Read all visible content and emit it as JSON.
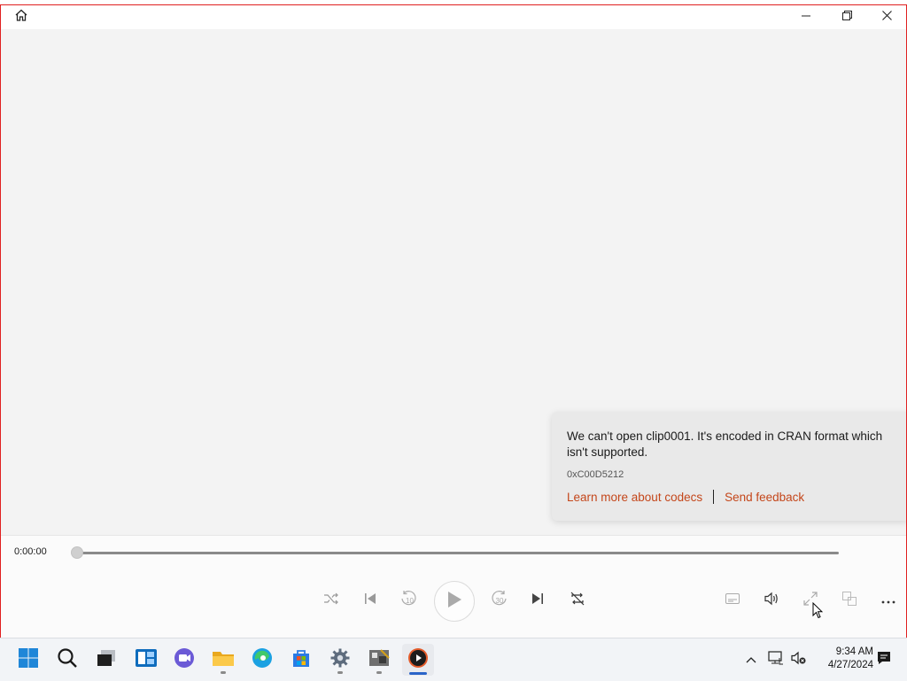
{
  "window": {
    "home_icon": "home-icon",
    "controls": [
      "minimize-icon",
      "restore-icon",
      "close-icon"
    ]
  },
  "error_toast": {
    "message": "We can't open clip0001. It's encoded in CRAN format which isn't supported.",
    "code": "0xC00D5212",
    "learn_more": "Learn more about codecs",
    "feedback": "Send feedback",
    "link_color": "#c4461a"
  },
  "player": {
    "current_time": "0:00:00",
    "progress": 0,
    "buttons": [
      "shuffle-icon",
      "previous-icon",
      "rewind-10-icon",
      "play-icon",
      "forward-30-icon",
      "next-icon",
      "repeat-icon",
      "subtitles-icon",
      "volume-icon",
      "fullscreen-icon",
      "mini-player-icon",
      "more-icon"
    ],
    "rewind_label": "10",
    "forward_label": "30"
  },
  "taskbar": {
    "apps": [
      "start-icon",
      "search-icon",
      "task-view-icon",
      "widgets-icon",
      "chat-icon",
      "file-explorer-icon",
      "edge-icon",
      "store-icon",
      "settings-icon",
      "app-icon",
      "media-player-icon"
    ],
    "time": "9:34 AM",
    "date": "4/27/2024",
    "accent": "#2a64c8"
  }
}
